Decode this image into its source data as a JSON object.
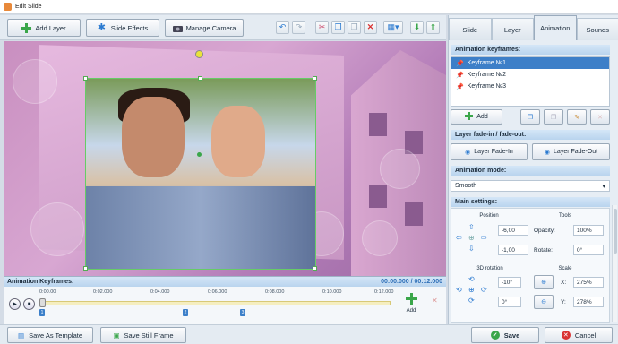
{
  "window": {
    "title": "Edit Slide"
  },
  "toolbar": {
    "add_layer": "Add Layer",
    "slide_effects": "Slide Effects",
    "manage_camera": "Manage Camera"
  },
  "side_tabs": [
    "Slide",
    "Layer",
    "Animation",
    "Sounds"
  ],
  "animation_keyframes": {
    "header": "Animation keyframes:",
    "items": [
      "Keyframe №1",
      "Keyframe №2",
      "Keyframe №3"
    ],
    "add_label": "Add"
  },
  "fade": {
    "header": "Layer fade-in / fade-out:",
    "fade_in": "Layer Fade-In",
    "fade_out": "Layer Fade-Out"
  },
  "mode": {
    "header": "Animation mode:",
    "value": "Smooth"
  },
  "main_settings": {
    "header": "Main settings:",
    "position_label": "Position",
    "tools_label": "Tools",
    "pos_x": "-6,00",
    "pos_y": "-1,00",
    "opacity_label": "Opacity:",
    "opacity_value": "100%",
    "rotate_label": "Rotate:",
    "rotate_value": "0°",
    "rotation3d_label": "3D rotation",
    "scale_label": "Scale",
    "rot_x": "-10°",
    "rot_y": "0°",
    "scale_x_label": "X:",
    "scale_x": "275%",
    "scale_y_label": "Y:",
    "scale_y": "278%"
  },
  "timeline": {
    "header": "Animation Keyframes:",
    "time": "00:00.000 / 00:12.000",
    "ticks": [
      "0:00.00",
      "0:02.000",
      "0:04.000",
      "0:06.000",
      "0:08.000",
      "0:10.000",
      "0:12.000"
    ],
    "markers": [
      "1",
      "2",
      "3"
    ],
    "add_label": "Add"
  },
  "bottom": {
    "save_template": "Save As Template",
    "save_still": "Save Still Frame",
    "save": "Save",
    "cancel": "Cancel"
  },
  "colors": {
    "accent": "#3d7fc8",
    "section": "#b9d4ee",
    "green": "#3aa64a",
    "red": "#d93232"
  }
}
